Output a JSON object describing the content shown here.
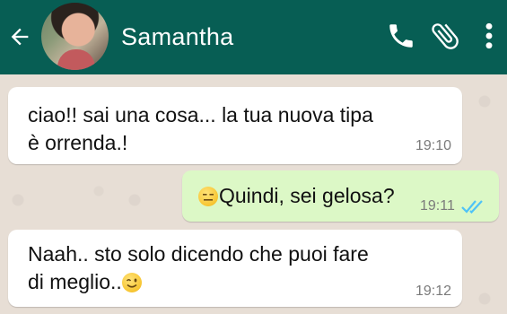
{
  "header": {
    "contact_name": "Samantha",
    "background_color": "#075e54",
    "icons": [
      "back-arrow-icon",
      "contact-avatar",
      "phone-icon",
      "attachment-icon",
      "more-vert-icon"
    ]
  },
  "messages": [
    {
      "direction": "incoming",
      "text": "ciao!! sai una cosa... la tua nuova tipa\nè orrenda.!",
      "time": "19:10"
    },
    {
      "direction": "outgoing",
      "emoji": "expressionless-face",
      "text": "Quindi, sei gelosa?",
      "time": "19:11",
      "status": "read",
      "status_icon": "double-check-icon",
      "status_color": "#4fc3f7"
    },
    {
      "direction": "incoming",
      "text": "Naah.. sto solo dicendo che puoi fare\ndi meglio..",
      "emoji": "winking-face",
      "time": "19:12"
    }
  ],
  "colors": {
    "incoming_bubble": "#ffffff",
    "outgoing_bubble": "#dcf8c6",
    "chat_background": "#e7ded5"
  }
}
